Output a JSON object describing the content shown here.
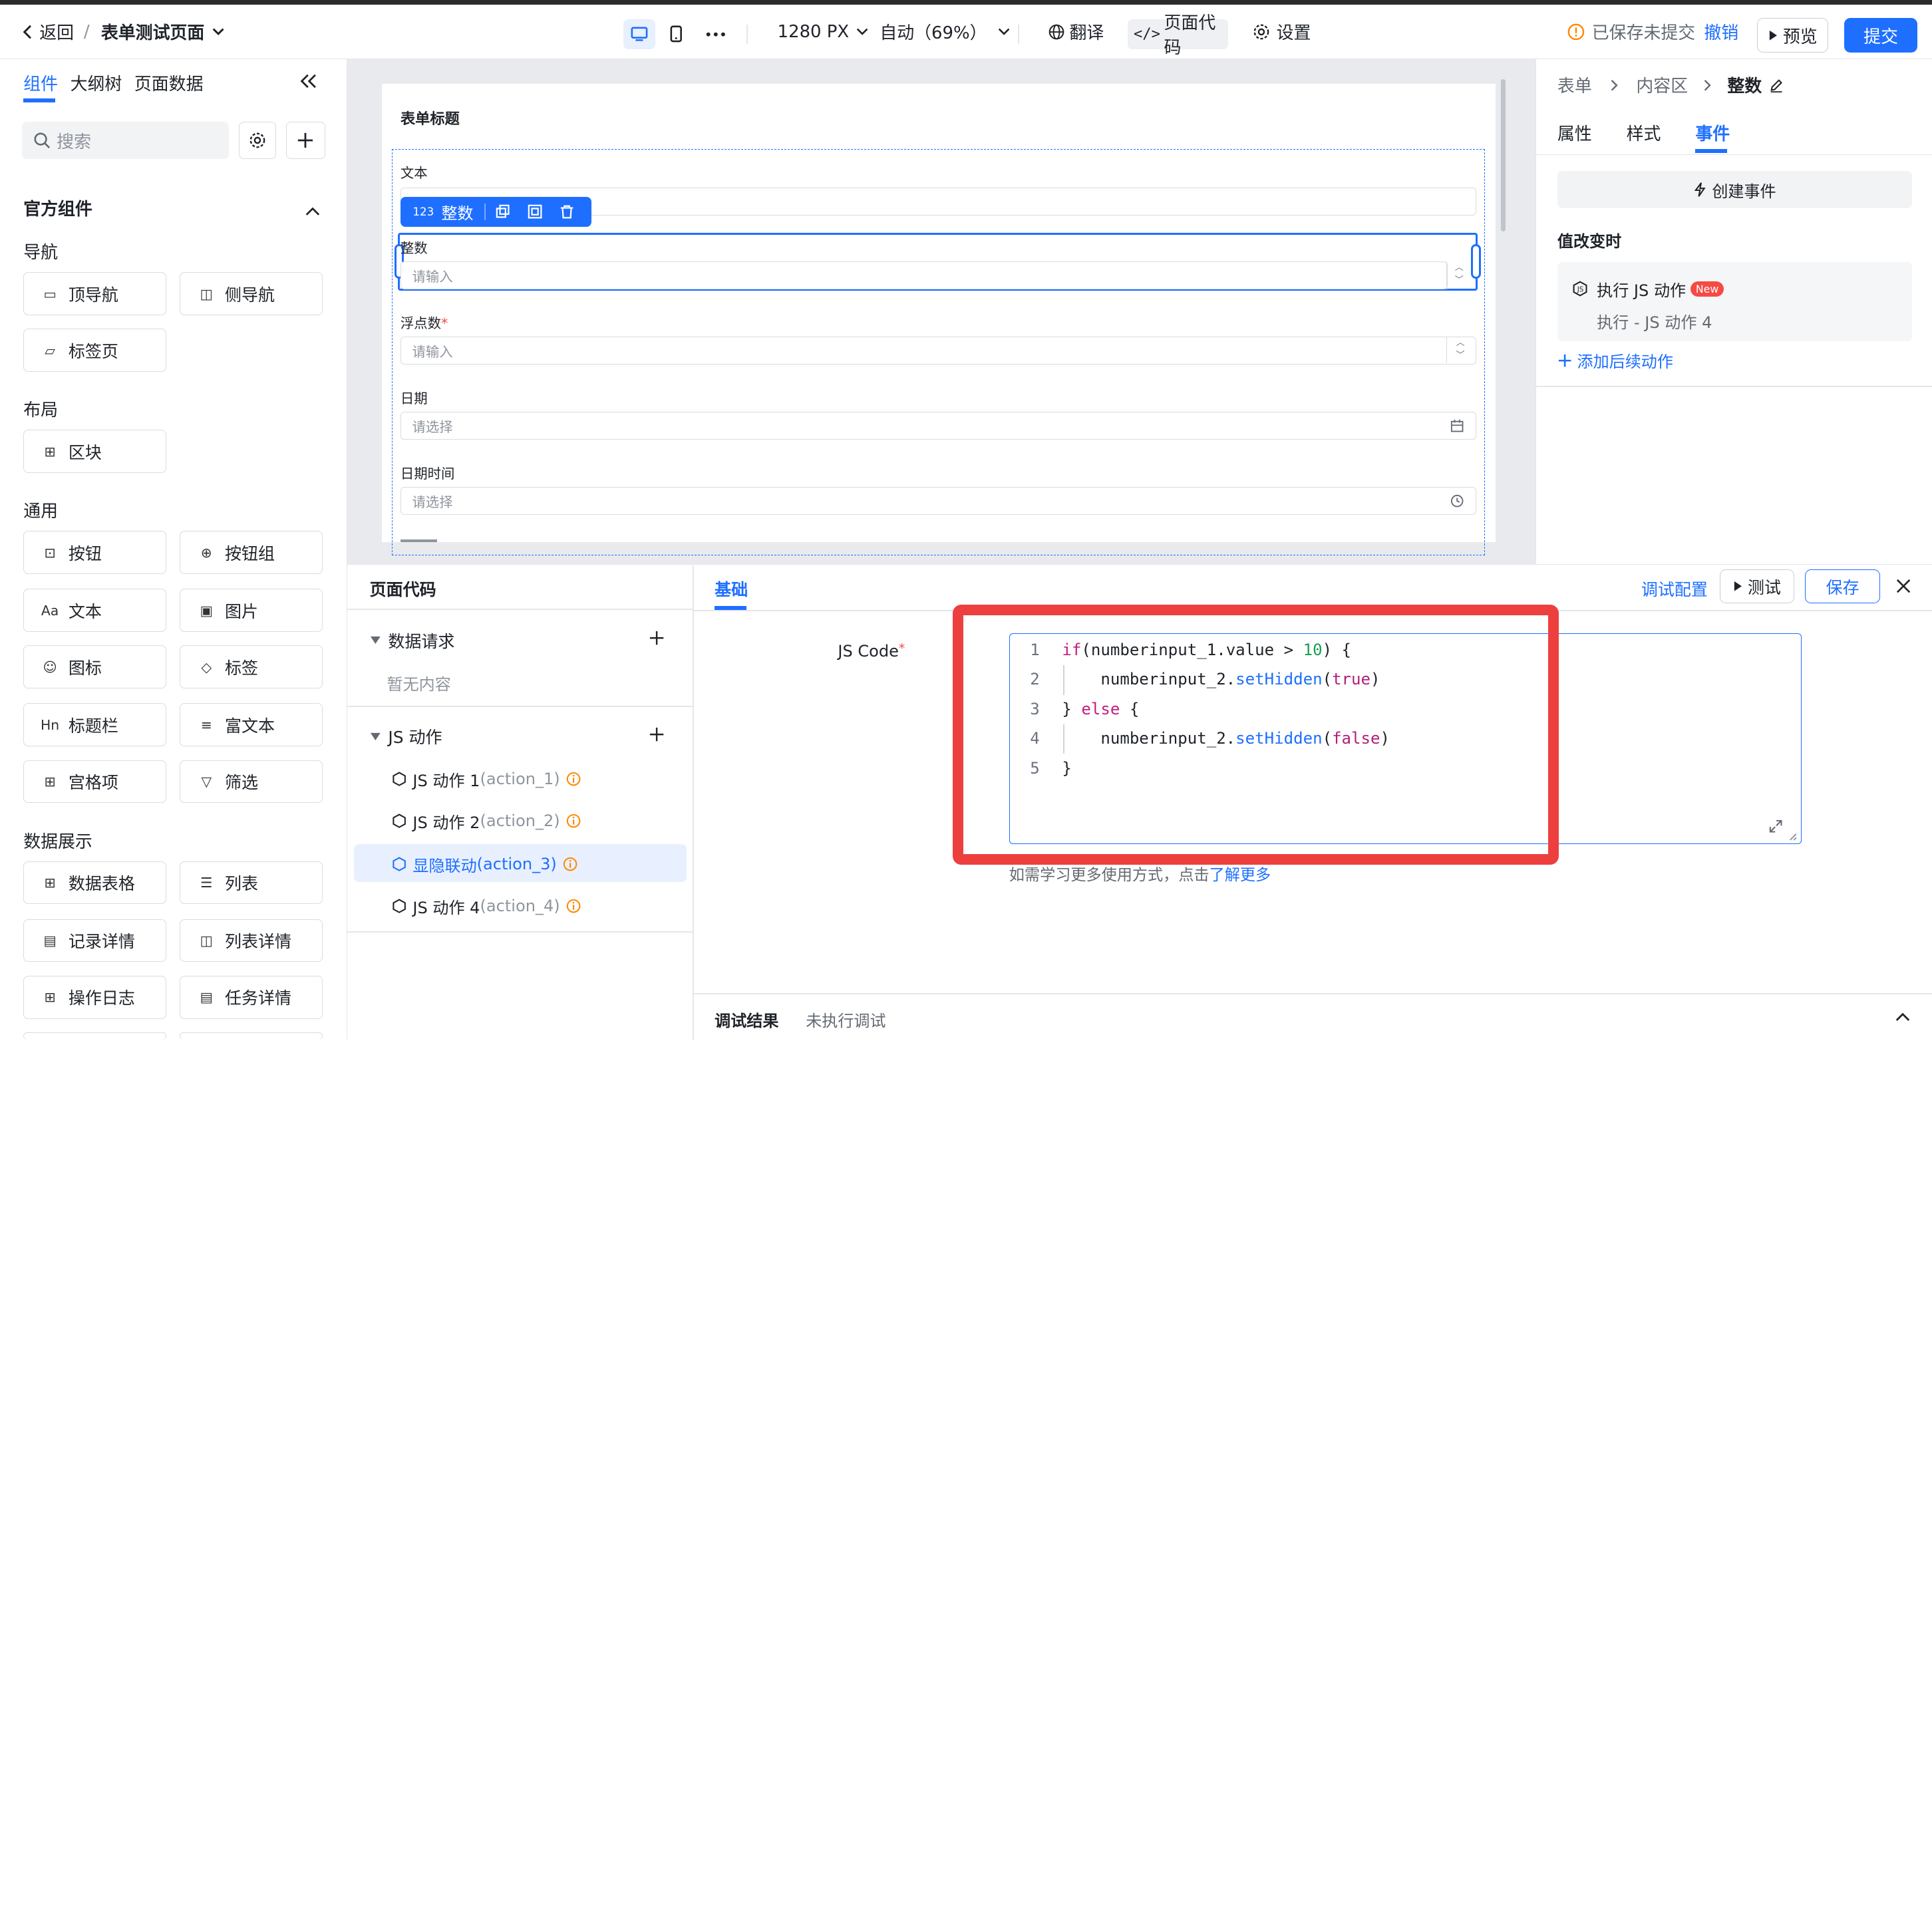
{
  "topbar": {
    "back": "返回",
    "page_title": "表单测试页面",
    "width_select": "1280 PX",
    "zoom_select": "自动（69%）",
    "translate": "翻译",
    "page_code": "页面代码",
    "settings": "设置",
    "saved_status": "已保存未提交",
    "undo": "撤销",
    "preview": "预览",
    "submit": "提交"
  },
  "left": {
    "tabs": [
      "组件",
      "大纲树",
      "页面数据"
    ],
    "search_placeholder": "搜索",
    "official_title": "官方组件",
    "groups": [
      {
        "title": "导航",
        "items": [
          "顶导航",
          "侧导航",
          "标签页"
        ]
      },
      {
        "title": "布局",
        "items": [
          "区块"
        ]
      },
      {
        "title": "通用",
        "items": [
          "按钮",
          "按钮组",
          "文本",
          "图片",
          "图标",
          "标签",
          "标题栏",
          "富文本",
          "宫格项",
          "筛选"
        ]
      },
      {
        "title": "数据展示",
        "items": [
          "数据表格",
          "列表",
          "记录详情",
          "列表详情",
          "操作日志",
          "任务详情"
        ]
      }
    ]
  },
  "canvas": {
    "form_title": "表单标题",
    "text_label": "文本",
    "selected_tag": "整数",
    "selected_tag_prefix": "123",
    "integer_label": "整数",
    "integer_placeholder": "请输入",
    "float_label": "浮点数",
    "required_star": "*",
    "float_placeholder": "请输入",
    "date_label": "日期",
    "date_placeholder": "请选择",
    "datetime_label": "日期时间",
    "datetime_placeholder": "请选择"
  },
  "right": {
    "breadcrumb": [
      "表单",
      "内容区",
      "整数"
    ],
    "tabs": [
      "属性",
      "样式",
      "事件"
    ],
    "create_event": "创建事件",
    "on_change": "值改变时",
    "action_title": "执行 JS 动作",
    "new_badge": "New",
    "action_desc": "执行 - JS 动作 4",
    "add_follow": "添加后续动作"
  },
  "bottom": {
    "panel_title": "页面代码",
    "data_request": "数据请求",
    "empty": "暂无内容",
    "js_actions": "JS 动作",
    "actions": [
      {
        "name": "JS 动作 1",
        "id": "(action_1)"
      },
      {
        "name": "JS 动作 2",
        "id": "(action_2)"
      },
      {
        "name": "显隐联动",
        "id": "(action_3)"
      },
      {
        "name": "JS 动作 4",
        "id": "(action_4)"
      }
    ],
    "tab_basic": "基础",
    "debug_config": "调试配置",
    "test": "测试",
    "save": "保存",
    "js_code_label": "JS Code",
    "code_lines": [
      "1",
      "2",
      "3",
      "4",
      "5"
    ],
    "hint": "如需学习更多使用方式，点击",
    "hint_link": "了解更多",
    "debug_result": "调试结果",
    "debug_status": "未执行调试"
  },
  "colors": {
    "accent": "#1e6fff",
    "highlight": "#ee3f3f"
  }
}
